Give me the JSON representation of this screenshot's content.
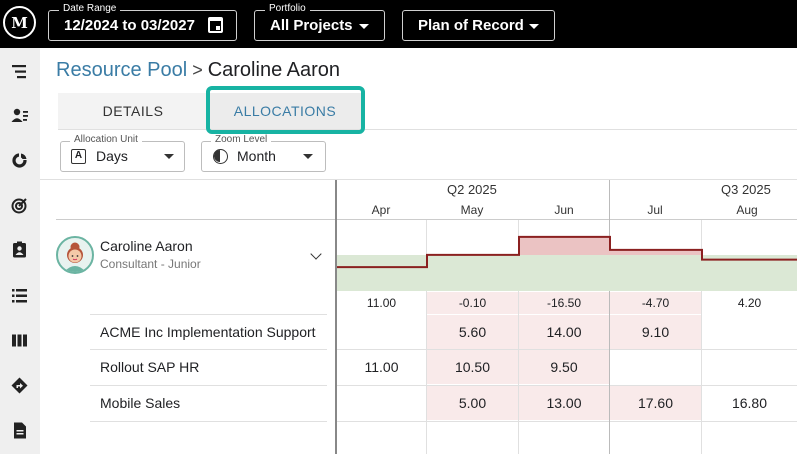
{
  "topbar": {
    "logo": "M",
    "date_range": {
      "legend": "Date Range",
      "value": "12/2024 to 03/2027"
    },
    "portfolio": {
      "legend": "Portfolio",
      "value": "All Projects"
    },
    "plan": {
      "value": "Plan of Record"
    }
  },
  "sidebar": {
    "icons": [
      "list-tree-icon",
      "user-list-icon",
      "donut-chart-icon",
      "target-icon",
      "clipboard-user-icon",
      "list-icon",
      "columns-icon",
      "directions-icon",
      "document-icon"
    ]
  },
  "breadcrumb": {
    "parent": "Resource Pool",
    "separator": ">",
    "current": "Caroline Aaron"
  },
  "tabs": [
    {
      "label": "DETAILS"
    },
    {
      "label": "ALLOCATIONS"
    }
  ],
  "allocation_unit": {
    "legend": "Allocation Unit",
    "value": "Days"
  },
  "zoom_level": {
    "legend": "Zoom Level",
    "value": "Month"
  },
  "timeline": {
    "quarters": [
      "Q2 2025",
      "Q3 2025"
    ],
    "months": [
      "Apr",
      "May",
      "Jun",
      "Jul",
      "Aug"
    ]
  },
  "resource": {
    "name": "Caroline Aaron",
    "role": "Consultant - Junior",
    "remaining": [
      "11.00",
      "-0.10",
      "-16.50",
      "-4.70",
      "4.20"
    ]
  },
  "projects": [
    {
      "name": "ACME Inc Implementation Support",
      "values": [
        "",
        "5.60",
        "14.00",
        "9.10",
        ""
      ]
    },
    {
      "name": "Rollout SAP HR",
      "values": [
        "11.00",
        "10.50",
        "9.50",
        "",
        ""
      ]
    },
    {
      "name": "Mobile Sales",
      "values": [
        "",
        "5.00",
        "13.00",
        "17.60",
        "16.80"
      ]
    }
  ],
  "colors": {
    "accent": "#3a7ca5",
    "highlight": "#17b3a3",
    "capacity": "#dbe8d5",
    "over": "#ebc3c3",
    "over_line": "#8b2020"
  }
}
